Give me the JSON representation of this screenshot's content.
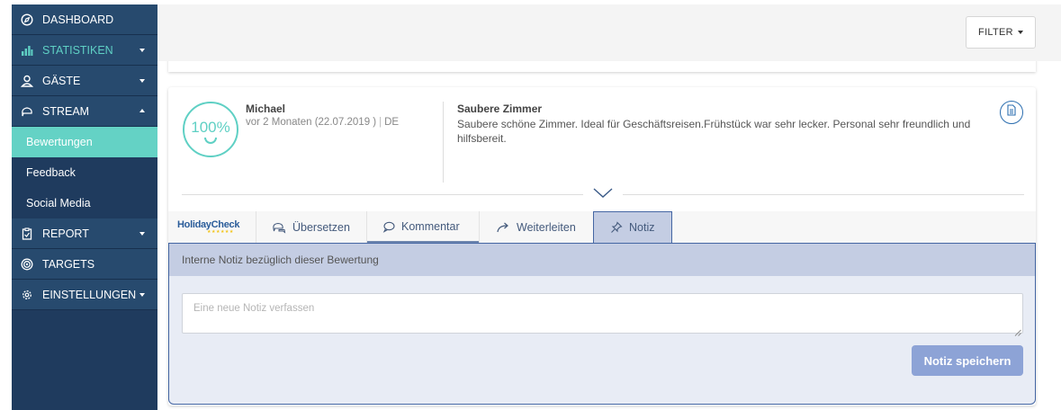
{
  "sidebar": {
    "items": [
      {
        "label": "DASHBOARD",
        "icon": "compass-icon"
      },
      {
        "label": "STATISTIKEN",
        "icon": "bar-chart-icon"
      },
      {
        "label": "GÄSTE",
        "icon": "user-icon"
      },
      {
        "label": "STREAM",
        "icon": "chat-bubble-icon"
      },
      {
        "label": "REPORT",
        "icon": "clipboard-icon"
      },
      {
        "label": "TARGETS",
        "icon": "target-icon"
      },
      {
        "label": "EINSTELLUNGEN",
        "icon": "gear-icon"
      }
    ],
    "subitems": [
      {
        "label": "Bewertungen"
      },
      {
        "label": "Feedback"
      },
      {
        "label": "Social Media"
      }
    ]
  },
  "header": {
    "filter_label": "FILTER"
  },
  "review": {
    "score": "100%",
    "author": "Michael",
    "date": "vor 2 Monaten (22.07.2019 )",
    "lang": "DE",
    "title": "Saubere Zimmer",
    "text": "Saubere schöne Zimmer. Ideal für Geschäftsreisen.Frühstück war sehr lecker. Personal sehr freundlich und hilfsbereit."
  },
  "tabs": {
    "source": "HolidayCheck",
    "source_stars": "★★★★★★",
    "translate": "Übersetzen",
    "comment": "Kommentar",
    "forward": "Weiterleiten",
    "note": "Notiz"
  },
  "note": {
    "heading": "Interne Notiz bezüglich dieser Bewertung",
    "placeholder": "Eine neue Notiz verfassen",
    "save_label": "Notiz speichern"
  },
  "colors": {
    "sidebar_bg": "#1f3b5e",
    "accent_teal": "#64d2c5",
    "note_bg": "#c4cde3",
    "save_button": "#8da3d6"
  }
}
